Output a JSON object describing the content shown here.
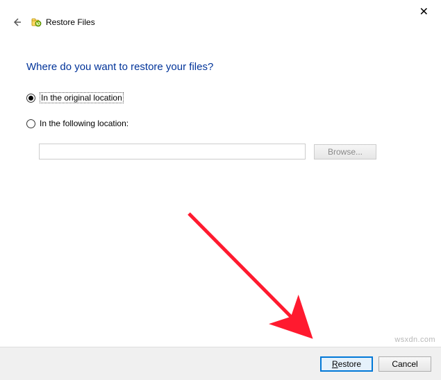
{
  "window": {
    "title": "Restore Files"
  },
  "heading": "Where do you want to restore your files?",
  "options": {
    "original": "In the original location",
    "following": "In the following location:",
    "path_value": ""
  },
  "buttons": {
    "browse": "Browse...",
    "restore_prefix": "R",
    "restore_rest": "estore",
    "cancel": "Cancel"
  },
  "watermark": "wsxdn.com"
}
